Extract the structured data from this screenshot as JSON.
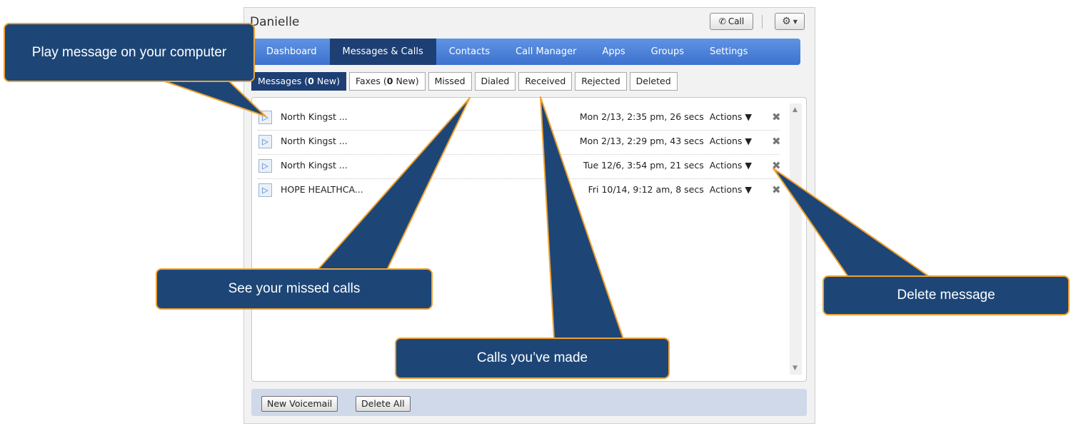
{
  "window": {
    "title": "Danielle",
    "call_label": "Call"
  },
  "nav": {
    "tabs": [
      "Dashboard",
      "Messages & Calls",
      "Contacts",
      "Call Manager",
      "Apps",
      "Groups",
      "Settings"
    ],
    "active": 1
  },
  "subtabs": [
    {
      "label_pre": "Messages (",
      "count": "0",
      "label_post": " New)",
      "active": true
    },
    {
      "label_pre": "Faxes (",
      "count": "0",
      "label_post": " New)",
      "active": false
    },
    {
      "label_pre": "Missed"
    },
    {
      "label_pre": "Dialed"
    },
    {
      "label_pre": "Received"
    },
    {
      "label_pre": "Rejected"
    },
    {
      "label_pre": "Deleted"
    }
  ],
  "messages": [
    {
      "caller": "North Kingst ...",
      "meta": "Mon 2/13, 2:35 pm, 26 secs",
      "actions": "Actions ▼"
    },
    {
      "caller": "North Kingst ...",
      "meta": "Mon 2/13, 2:29 pm, 43 secs",
      "actions": "Actions ▼"
    },
    {
      "caller": "North Kingst ...",
      "meta": "Tue 12/6, 3:54 pm, 21 secs",
      "actions": "Actions ▼"
    },
    {
      "caller": "HOPE HEALTHCA...",
      "meta": "Fri 10/14, 9:12 am, 8 secs",
      "actions": "Actions ▼"
    }
  ],
  "footer": {
    "new_voicemail": "New Voicemail",
    "delete_all": "Delete All"
  },
  "callouts": {
    "play": "Play message on your computer",
    "missed": "See your missed calls",
    "dialed": "Calls you’ve made",
    "delete": "Delete message"
  },
  "colors": {
    "callout_fill": "#1d4677",
    "callout_border": "#f0a230",
    "nav_active": "#1d3f74",
    "nav_bg": "#4a80d8"
  },
  "icons": {
    "play": "play-icon",
    "phone": "phone-icon",
    "gear": "gear-icon",
    "delete": "delete-x-icon"
  }
}
